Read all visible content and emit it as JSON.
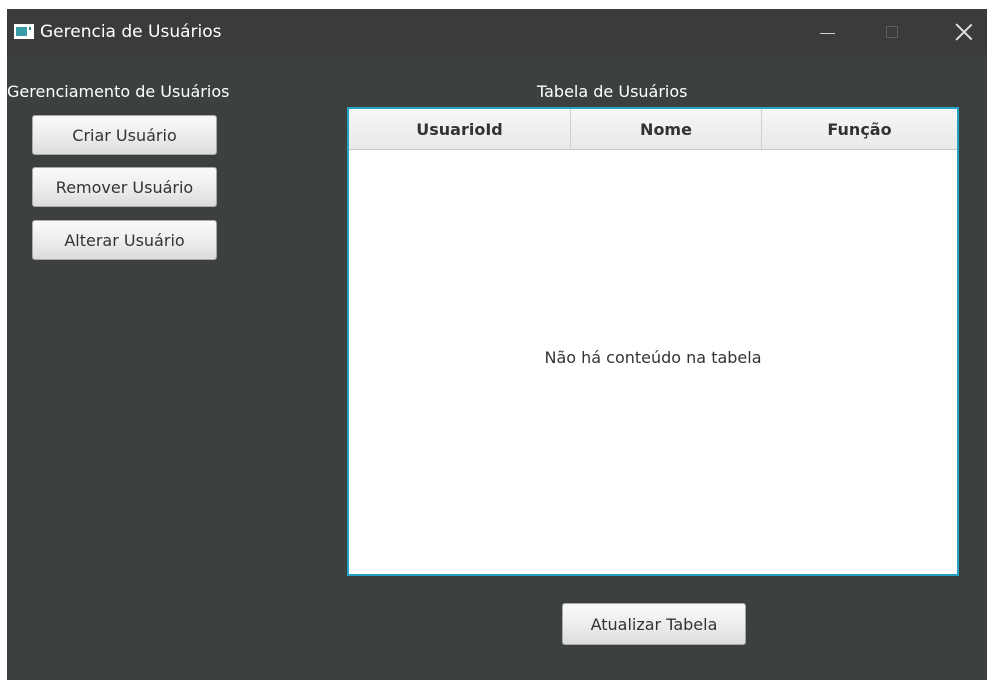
{
  "window": {
    "title": "Gerencia de Usuários",
    "icon": "app-window-icon",
    "controls": {
      "minimize": "minimize-icon",
      "maximize": "maximize-icon",
      "close": "close-icon"
    }
  },
  "sidebar": {
    "title": "Gerenciamento de Usuários",
    "buttons": {
      "create": "Criar Usuário",
      "remove": "Remover Usuário",
      "edit": "Alterar Usuário"
    }
  },
  "table": {
    "title": "Tabela de Usuários",
    "columns": [
      "UsuarioId",
      "Nome",
      "Função"
    ],
    "rows": [],
    "empty_text": "Não há conteúdo na tabela"
  },
  "footer": {
    "refresh_button": "Atualizar Tabela"
  },
  "colors": {
    "window_background": "#3c4140",
    "titlebar_background": "#3a3b3a",
    "table_focus_border": "#22a3c7"
  }
}
